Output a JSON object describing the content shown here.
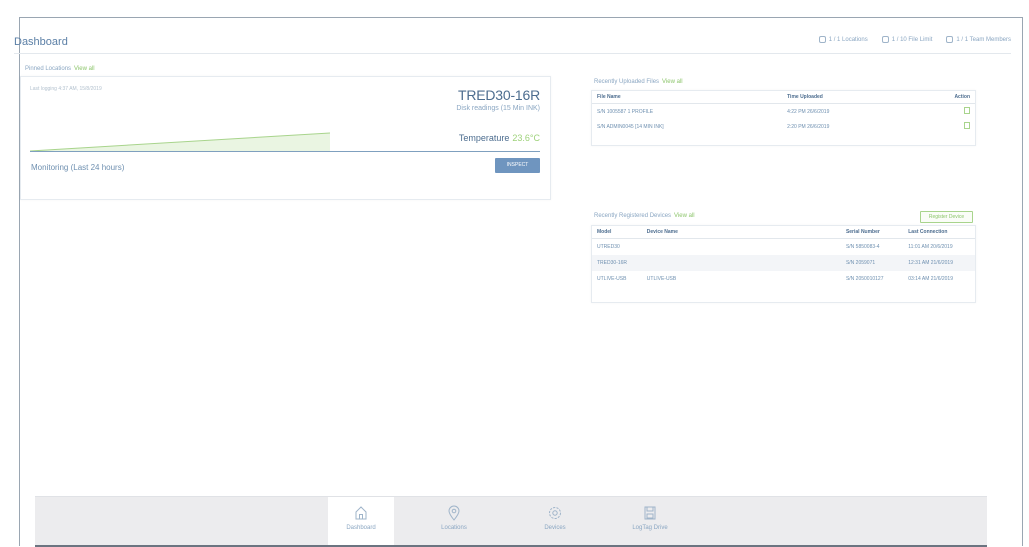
{
  "page": {
    "title": "Dashboard"
  },
  "header_stats": [
    {
      "icon": "location-icon",
      "label": "1 / 1 Locations"
    },
    {
      "icon": "file-icon",
      "label": "1 / 10 File Limit"
    },
    {
      "icon": "team-icon",
      "label": "1 / 1 Team Members"
    }
  ],
  "pinned": {
    "heading": "Pinned Locations",
    "view_all": "View all",
    "logging_text": "Last logging 4:37 AM, 15/8/2019",
    "device_name": "TRED30-16R",
    "device_sub": "Disk readings (15 Min INK)",
    "temperature_label": "Temperature",
    "temperature_value": "23.6°C",
    "monitoring_label": "Monitoring (Last 24 hours)",
    "button_label": "INSPECT",
    "accent": "#9ed27a"
  },
  "files": {
    "heading": "Recently Uploaded Files",
    "view_all": "View all",
    "columns": [
      "File Name",
      "Time Uploaded",
      "Action"
    ],
    "rows": [
      {
        "name": "S/N 1005587 1 PROFILE",
        "time": "4:22 PM 26/6/2019"
      },
      {
        "name": "S/N ADMIN0045 [14 MIN INK]",
        "time": "2:20 PM 26/6/2019"
      }
    ]
  },
  "devices": {
    "heading": "Recently Registered Devices",
    "view_all": "View all",
    "register_button": "Register Device",
    "columns": [
      "Model",
      "Device Name",
      "Serial Number",
      "Last Connection"
    ],
    "rows": [
      {
        "model": "UTRED30",
        "name": "",
        "serial": "S/N 5850083-4",
        "last": "11:01 AM 20/6/2019"
      },
      {
        "model": "TRED30-16R",
        "name": "",
        "serial": "S/N 2059071",
        "last": "12:31 AM 21/6/2019"
      },
      {
        "model": "UTLIVE-USB",
        "name": "UTLIVE-USB",
        "serial": "S/N 2050010127",
        "last": "03:14 AM 21/6/2019"
      }
    ]
  },
  "nav": {
    "items": [
      {
        "icon": "home-icon",
        "label": "Dashboard",
        "active": true
      },
      {
        "icon": "location-pin-icon",
        "label": "Locations",
        "active": false
      },
      {
        "icon": "gear-icon",
        "label": "Devices",
        "active": false
      },
      {
        "icon": "save-icon",
        "label": "LogTag Drive",
        "active": false
      }
    ]
  }
}
